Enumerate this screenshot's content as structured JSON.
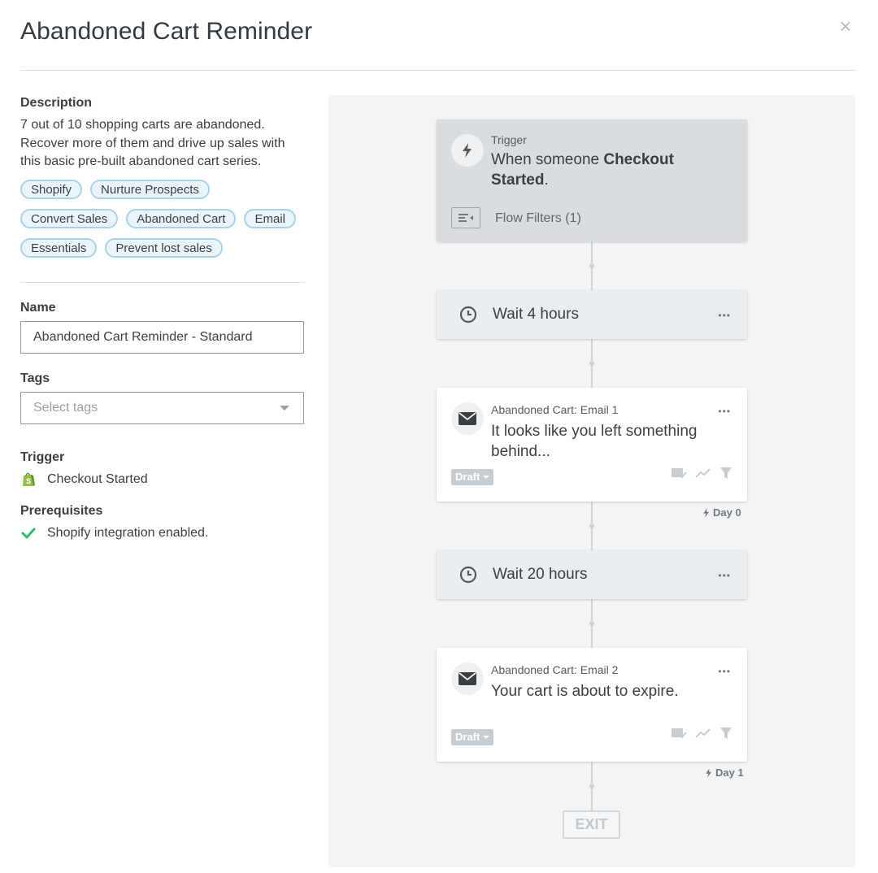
{
  "modal": {
    "title": "Abandoned Cart Reminder",
    "close_label": "×"
  },
  "details": {
    "description_label": "Description",
    "description": "7 out of 10 shopping carts are abandoned. Recover more of them and drive up sales with this basic pre-built abandoned cart series.",
    "tags": [
      "Shopify",
      "Nurture Prospects",
      "Convert Sales",
      "Abandoned Cart",
      "Email",
      "Essentials",
      "Prevent lost sales"
    ]
  },
  "form": {
    "name_label": "Name",
    "name_value": "Abandoned Cart Reminder - Standard",
    "tags_label": "Tags",
    "tags_placeholder": "Select tags",
    "trigger_label": "Trigger",
    "trigger_value": "Checkout Started",
    "prereq_label": "Prerequisites",
    "prereq_value": "Shopify integration enabled."
  },
  "flow": {
    "trigger": {
      "label": "Trigger",
      "text_prefix": "When someone ",
      "text_bold": "Checkout Started",
      "text_suffix": ".",
      "filters_label": "Flow Filters (1)"
    },
    "wait1": {
      "label": "Wait 4 hours"
    },
    "email1": {
      "label": "Abandoned Cart: Email 1",
      "subject": "It looks like you left something behind...",
      "status": "Draft",
      "day": "Day 0"
    },
    "wait2": {
      "label": "Wait 20 hours"
    },
    "email2": {
      "label": "Abandoned Cart: Email 2",
      "subject": "Your cart is about to expire.",
      "status": "Draft",
      "day": "Day 1"
    },
    "exit_label": "EXIT",
    "more_label": "•••"
  },
  "colors": {
    "tag_border": "#a9d3ea",
    "tag_bg": "#eaf5fb",
    "check_green": "#2fbd72",
    "shopify_green": "#95bf47",
    "canvas_bg": "#f3f4f5"
  }
}
